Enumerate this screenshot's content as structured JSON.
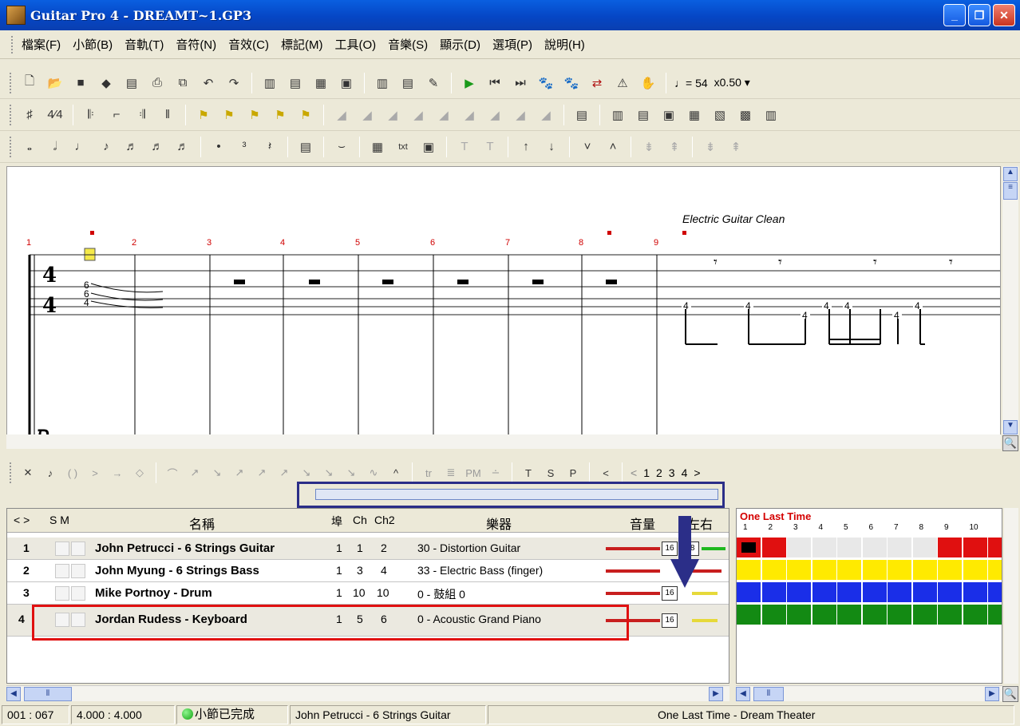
{
  "window": {
    "title": "Guitar Pro 4 - DREAMT~1.GP3",
    "minimize": "_",
    "restore": "❐",
    "close": "✕"
  },
  "menu": [
    "檔案(F)",
    "小節(B)",
    "音軌(T)",
    "音符(N)",
    "音效(C)",
    "標記(M)",
    "工具(O)",
    "音樂(S)",
    "顯示(D)",
    "選項(P)",
    "說明(H)"
  ],
  "toolbar1": {
    "tempo": "♩= 54",
    "speed": "x0.50 ▾"
  },
  "fx_bar": {
    "pages": [
      "<",
      "1",
      "2",
      "3",
      "4",
      ">"
    ]
  },
  "score": {
    "instrument_label": "Electric Guitar Clean",
    "measures": [
      "1",
      "2",
      "3",
      "4",
      "5",
      "6",
      "7",
      "8",
      "9"
    ],
    "time_signature": {
      "top": "4",
      "bottom": "4"
    },
    "tab_notes_first": [
      "6",
      "6",
      "4"
    ],
    "tab_notes_right": [
      "4",
      "4",
      "4",
      "4",
      "4",
      "4",
      "4"
    ]
  },
  "tracks": {
    "headers": {
      "nav": "< >",
      "sm": "S M",
      "name": "名稱",
      "port": "埠",
      "ch": "Ch",
      "ch2": "Ch2",
      "instrument": "樂器",
      "volume": "音量",
      "pan": "左右"
    },
    "rows": [
      {
        "num": "1",
        "name": "John Petrucci - 6 Strings Guitar",
        "port": "1",
        "ch": "1",
        "ch2": "2",
        "instrument": "30 - Distortion Guitar",
        "vol": "16",
        "pan": "-8"
      },
      {
        "num": "2",
        "name": "John Myung - 6 Strings Bass",
        "port": "1",
        "ch": "3",
        "ch2": "4",
        "instrument": "33 - Electric Bass (finger)",
        "vol": "",
        "pan": ""
      },
      {
        "num": "3",
        "name": "Mike Portnoy - Drum",
        "port": "1",
        "ch": "10",
        "ch2": "10",
        "instrument": "0 - 鼓組 0",
        "vol": "16",
        "pan": ""
      },
      {
        "num": "4",
        "name": "Jordan Rudess - Keyboard",
        "port": "1",
        "ch": "5",
        "ch2": "6",
        "instrument": "0 - Acoustic Grand Piano",
        "vol": "16",
        "pan": ""
      }
    ]
  },
  "pattern": {
    "title": "One Last Time",
    "numbers": [
      "1",
      "2",
      "3",
      "4",
      "5",
      "6",
      "7",
      "8",
      "9",
      "10"
    ],
    "colors": {
      "track1": "#e01010",
      "track2": "#ffea00",
      "track3": "#1a2ee8",
      "track4": "#138a13"
    }
  },
  "status": {
    "position": "001 : 067",
    "time": "4.000 : 4.000",
    "complete": "小節已完成",
    "track": "John Petrucci - 6 Strings Guitar",
    "song": "One Last Time - Dream Theater"
  }
}
